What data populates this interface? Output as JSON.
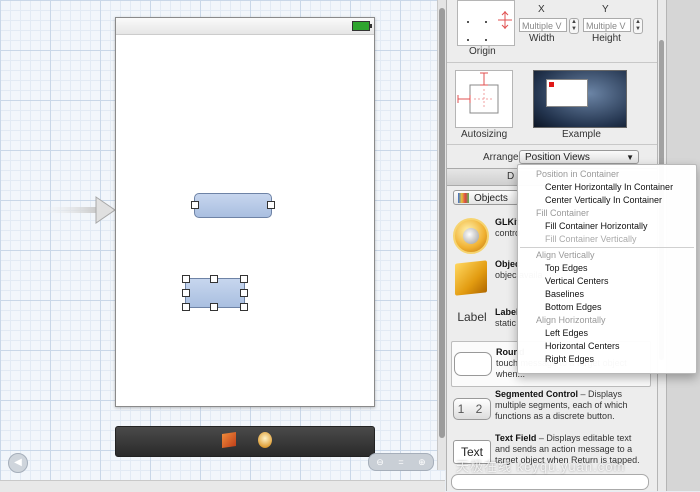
{
  "inspector": {
    "origin_label": "Origin",
    "x_label": "X",
    "y_label": "Y",
    "width_label": "Width",
    "height_label": "Height",
    "width_value": "Multiple V",
    "height_value": "Multiple V",
    "autosizing_label": "Autosizing",
    "example_label": "Example",
    "arrange_label": "Arrange",
    "arrange_value": "Position Views",
    "library_tab_letter": "D"
  },
  "library": {
    "filter_label": "Objects",
    "items": [
      {
        "title": "GLKit",
        "desc": "contro"
      },
      {
        "title": "Objec",
        "desc": "objec  availa"
      },
      {
        "icon_text": "Label",
        "title": "Label",
        "desc": "static"
      },
      {
        "title": "Round",
        "desc": "touch  message to a target object when..."
      },
      {
        "icon_text": "1 2",
        "title": "Segmented Control",
        "desc": "– Displays multiple segments, each of which functions as a discrete button."
      },
      {
        "icon_text": "Text",
        "title": "Text Field",
        "desc": "– Displays editable text and sends an action message to a target object when Return is tapped."
      }
    ]
  },
  "menu": {
    "sections": [
      {
        "header": "Position in Container",
        "items": [
          {
            "label": "Center Horizontally In Container",
            "enabled": true
          },
          {
            "label": "Center Vertically In Container",
            "enabled": true
          }
        ]
      },
      {
        "header": "Fill Container",
        "items": [
          {
            "label": "Fill Container Horizontally",
            "enabled": true
          },
          {
            "label": "Fill Container Vertically",
            "enabled": false
          }
        ]
      },
      {
        "header": "Align Vertically",
        "items": [
          {
            "label": "Top Edges",
            "enabled": true
          },
          {
            "label": "Vertical Centers",
            "enabled": true
          },
          {
            "label": "Baselines",
            "enabled": true
          },
          {
            "label": "Bottom Edges",
            "enabled": true
          }
        ]
      },
      {
        "header": "Align Horizontally",
        "items": [
          {
            "label": "Left Edges",
            "enabled": true
          },
          {
            "label": "Horizontal Centers",
            "enabled": true
          },
          {
            "label": "Right Edges",
            "enabled": true
          }
        ]
      }
    ]
  },
  "watermark": "天极在线 keyqu.yuan.com",
  "colors": {
    "button_fill": "#b8cbe8",
    "grid_line": "#c9d7e8",
    "battery": "#2fa52f"
  }
}
